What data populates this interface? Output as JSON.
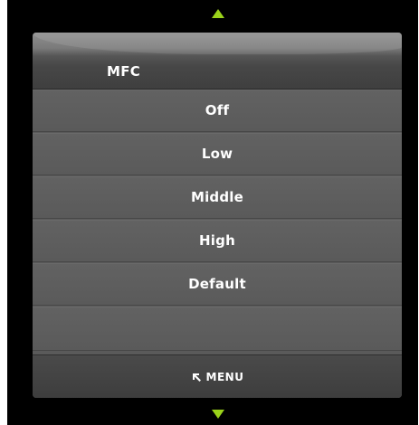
{
  "menu": {
    "title": "MFC",
    "options": [
      "Off",
      "Low",
      "Middle",
      "High",
      "Default"
    ],
    "footer_label": "MENU",
    "back_icon": "back-arrow-icon",
    "nav_up_icon": "scroll-up-arrow-icon",
    "nav_down_icon": "scroll-down-arrow-icon"
  },
  "colors": {
    "accent": "#9ad21a",
    "panel": "#5a5a5a",
    "background": "#000000"
  }
}
